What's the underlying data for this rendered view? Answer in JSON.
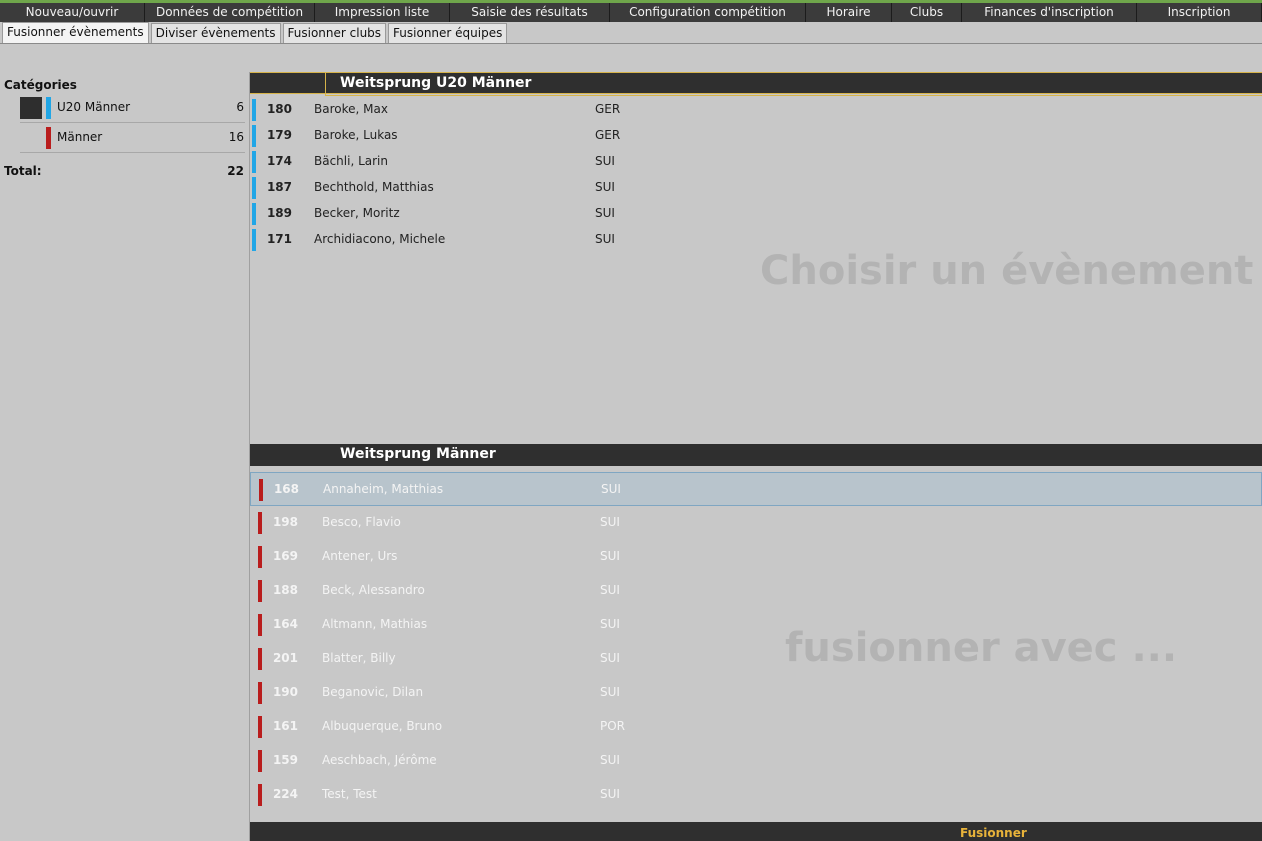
{
  "menu": [
    {
      "label": "Nouveau/ouvrir",
      "w": 145
    },
    {
      "label": "Données de compétition",
      "w": 170
    },
    {
      "label": "Impression liste",
      "w": 135
    },
    {
      "label": "Saisie des résultats",
      "w": 160
    },
    {
      "label": "Configuration compétition",
      "w": 196
    },
    {
      "label": "Horaire",
      "w": 86
    },
    {
      "label": "Clubs",
      "w": 70
    },
    {
      "label": "Finances d'inscription",
      "w": 175
    },
    {
      "label": "Inscription",
      "w": 125
    }
  ],
  "subtabs": [
    "Fusionner évènements",
    "Diviser évènements",
    "Fusionner clubs",
    "Fusionner équipes"
  ],
  "sidebar": {
    "heading": "Catégories",
    "categories": [
      {
        "label": "U20 Männer",
        "count": "6",
        "color": "#21a6e6"
      },
      {
        "label": "Männer",
        "count": "16",
        "color": "#b91d1d"
      }
    ],
    "total_label": "Total:",
    "total_count": "22"
  },
  "event1": {
    "title": "Weitsprung U20 Männer",
    "placeholder": "Choisir un évènement",
    "rows": [
      {
        "num": "180",
        "name": "Baroke, Max",
        "country": "GER"
      },
      {
        "num": "179",
        "name": "Baroke, Lukas",
        "country": "GER"
      },
      {
        "num": "174",
        "name": "Bächli, Larin",
        "country": "SUI"
      },
      {
        "num": "187",
        "name": "Bechthold, Matthias",
        "country": "SUI"
      },
      {
        "num": "189",
        "name": "Becker, Moritz",
        "country": "SUI"
      },
      {
        "num": "171",
        "name": "Archidiacono, Michele",
        "country": "SUI"
      }
    ]
  },
  "event2": {
    "title": "Weitsprung Männer",
    "placeholder": "fusionner avec ...",
    "rows": [
      {
        "num": "168",
        "name": "Annaheim, Matthias",
        "country": "SUI"
      },
      {
        "num": "198",
        "name": "Besco, Flavio",
        "country": "SUI"
      },
      {
        "num": "169",
        "name": "Antener, Urs",
        "country": "SUI"
      },
      {
        "num": "188",
        "name": "Beck, Alessandro",
        "country": "SUI"
      },
      {
        "num": "164",
        "name": "Altmann, Mathias",
        "country": "SUI"
      },
      {
        "num": "201",
        "name": "Blatter, Billy",
        "country": "SUI"
      },
      {
        "num": "190",
        "name": "Beganovic, Dilan",
        "country": "SUI"
      },
      {
        "num": "161",
        "name": "Albuquerque, Bruno",
        "country": "POR"
      },
      {
        "num": "159",
        "name": "Aeschbach, Jérôme",
        "country": "SUI"
      },
      {
        "num": "224",
        "name": "Test, Test",
        "country": "SUI"
      }
    ]
  },
  "footer": {
    "merge_label": "Fusionner"
  }
}
